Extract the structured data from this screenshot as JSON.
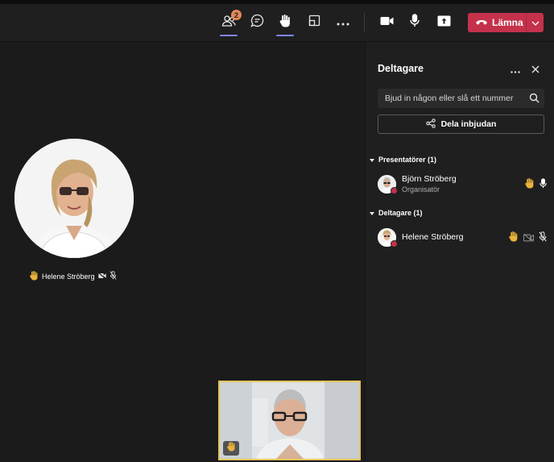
{
  "toolbar": {
    "people_badge": "2",
    "leave_label": "Lämna"
  },
  "stage": {
    "participant_name": "Helene Ströberg"
  },
  "panel": {
    "title": "Deltagare",
    "search_placeholder": "Bjud in någon eller slå ett nummer",
    "share_label": "Dela inbjudan",
    "sections": [
      {
        "label": "Presentatörer (1)",
        "people": [
          {
            "name": "Björn Ströberg",
            "role": "Organisatör"
          }
        ]
      },
      {
        "label": "Deltagare (1)",
        "people": [
          {
            "name": "Helene Ströberg",
            "role": ""
          }
        ]
      }
    ]
  },
  "colors": {
    "accent": "#7f85f5",
    "leave": "#c4314b",
    "hand": "#e9b23c",
    "self_view_border": "#e5c55a",
    "badge": "#e3885a"
  }
}
